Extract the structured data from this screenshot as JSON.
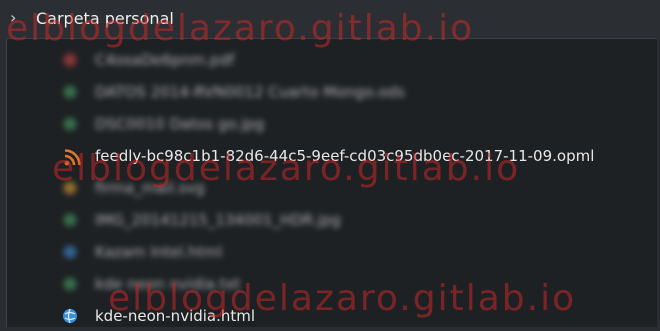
{
  "header": {
    "title": "Carpeta personal"
  },
  "files": [
    {
      "name": "C4osaDe6pnm.pdf",
      "icon": "pdf-icon",
      "blurred": true,
      "color": "#b84040"
    },
    {
      "name": "DATOS 2014-RVN0012 Cuarto Mongo.ods",
      "icon": "spreadsheet-icon",
      "blurred": true,
      "color": "#3f8f5a"
    },
    {
      "name": "DSC0010 Datos go.jpg",
      "icon": "image-icon",
      "blurred": true,
      "color": "#3f8f5a"
    },
    {
      "name": "feedly-bc98c1b1-82d6-44c5-9eef-cd03c95db0ec-2017-11-09.opml",
      "icon": "rss-feed-icon",
      "blurred": false,
      "color": "#e0762a"
    },
    {
      "name": "firma_mail.svg",
      "icon": "svg-icon",
      "blurred": true,
      "color": "#c08c30"
    },
    {
      "name": "IMG_20141215_134001_HDR.jpg",
      "icon": "image-icon",
      "blurred": true,
      "color": "#3f8f5a"
    },
    {
      "name": "Kazam Intel.html",
      "icon": "html-icon",
      "blurred": true,
      "color": "#3a7fbf"
    },
    {
      "name": "kde neon nvidia.txt",
      "icon": "text-icon",
      "blurred": true,
      "color": "#3f8f5a"
    },
    {
      "name": "kde-neon-nvidia.html",
      "icon": "html-globe-icon",
      "blurred": false,
      "color": "#3a8fd8"
    }
  ],
  "watermark": "elblogdelazaro.gitlab.io"
}
